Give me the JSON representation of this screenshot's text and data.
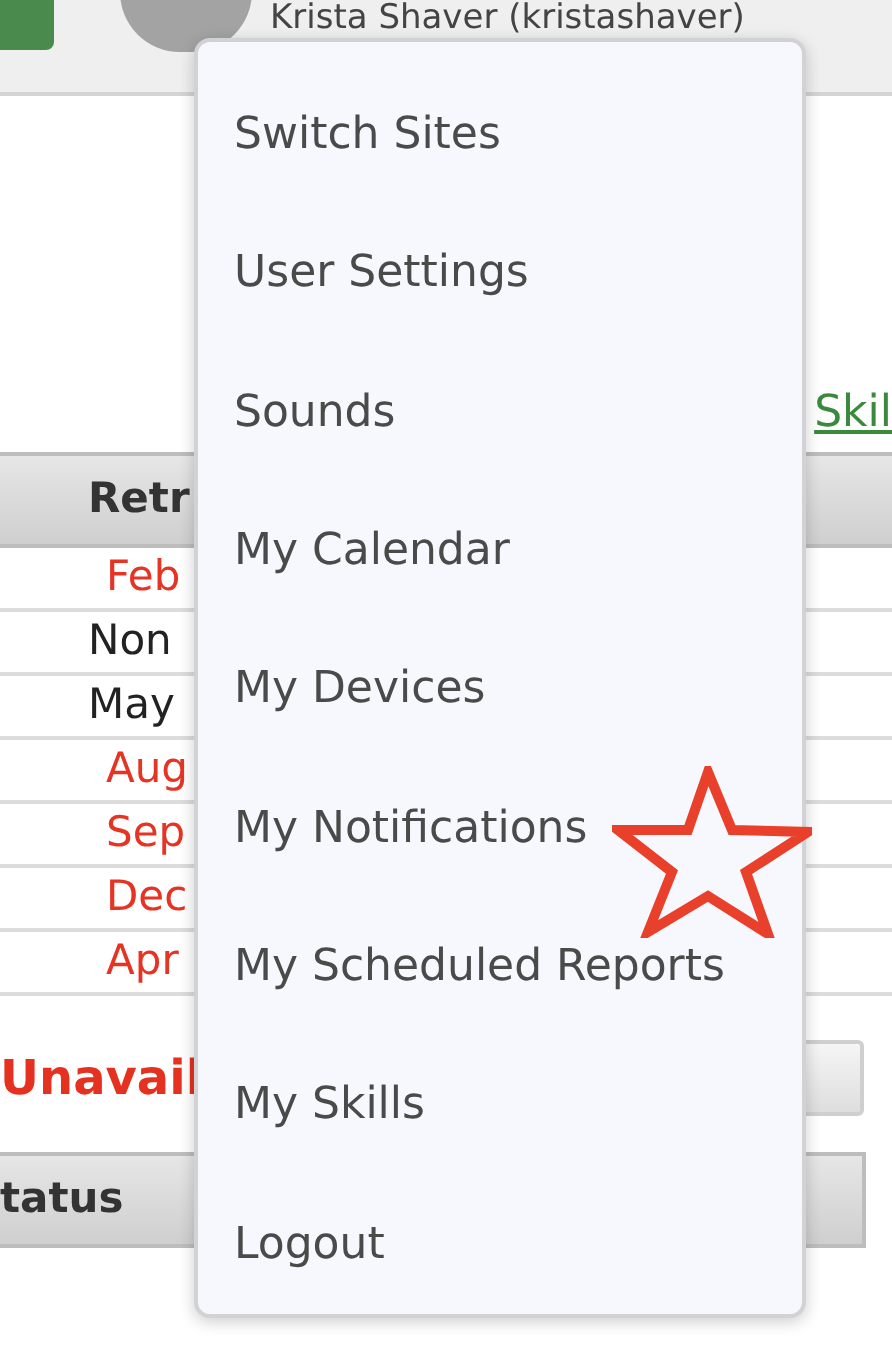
{
  "header": {
    "user_name": "Krista Shaver (kristashaver)"
  },
  "page": {
    "link": "Skil",
    "table": {
      "column_header": "Retr",
      "rows": [
        {
          "value": "Feb",
          "overdue": true
        },
        {
          "value": "Non",
          "overdue": false
        },
        {
          "value": "May",
          "overdue": false
        },
        {
          "value": "Aug",
          "overdue": true
        },
        {
          "value": "Sep",
          "overdue": true
        },
        {
          "value": "Dec",
          "overdue": true
        },
        {
          "value": "Apr",
          "overdue": true
        }
      ]
    },
    "section_title": "Unavail",
    "second_table": {
      "column_header": "tatus"
    }
  },
  "user_menu": {
    "items": [
      "Switch Sites",
      "User Settings",
      "Sounds",
      "My Calendar",
      "My Devices",
      "My Notifications",
      "My Scheduled Reports",
      "My Skills",
      "Logout"
    ]
  }
}
